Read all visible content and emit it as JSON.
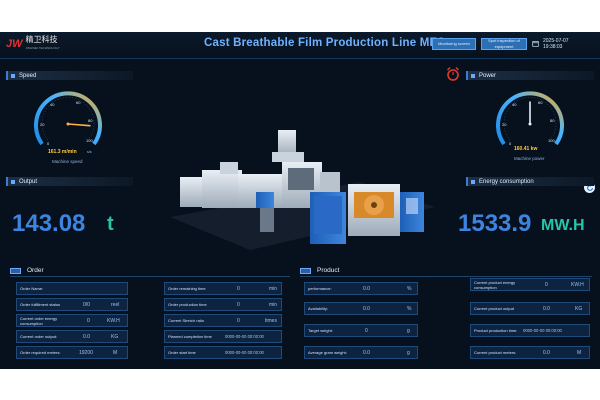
{
  "header": {
    "logo_mark": "JW",
    "logo_text": "精卫科技",
    "logo_sub": "JINGWEI TECHNOLOGY",
    "title": "Cast Breathable Film Production Line MES",
    "monitoring_btn": "Monitoring screen",
    "spot_btn": "Spot inspection of equipment",
    "date": "2025-07-07",
    "time": "19:38:03"
  },
  "speed": {
    "title": "Speed",
    "value": "161.3 m/min",
    "unit_small": "s/s",
    "caption": "Machine speed",
    "ticks": [
      "0",
      "20",
      "40",
      "60",
      "80",
      "100"
    ],
    "gauge_level": 0.85
  },
  "power": {
    "title": "Power",
    "value": "160.41 kw",
    "caption": "Machine power",
    "ticks": [
      "0",
      "20",
      "40",
      "60",
      "80",
      "100"
    ],
    "gauge_level": 0.5
  },
  "output": {
    "title": "Output",
    "value": "143.08",
    "unit": "t"
  },
  "energy": {
    "title": "Energy consumption",
    "value": "1533.9",
    "unit": "MW.H"
  },
  "order": {
    "title": "Order",
    "col1": [
      {
        "label": "Order Name:",
        "value": "",
        "unit": ""
      },
      {
        "label": "Order fulfillment status",
        "value": "0/0",
        "unit": "reel"
      },
      {
        "label": "Current order energy consumption",
        "value": "0",
        "unit": "KW.H"
      },
      {
        "label": "Current order output:",
        "value": "0.0",
        "unit": "KG"
      },
      {
        "label": "Order required meters:",
        "value": "19200",
        "unit": "M"
      }
    ],
    "col2": [
      {
        "label": "Order remaining time",
        "value": "0",
        "unit": "min"
      },
      {
        "label": "Order production time",
        "value": "0",
        "unit": "min"
      },
      {
        "label": "Current Stretch ratio",
        "value": "0",
        "unit": "times"
      },
      {
        "label": "Planned completion time",
        "value": "0000-00-00 00:00:00",
        "unit": ""
      },
      {
        "label": "Order start time",
        "value": "0000-00-00 00:00:00",
        "unit": ""
      }
    ]
  },
  "product": {
    "title": "Product",
    "col1": [
      {
        "label": "performance:",
        "value": "0.0",
        "unit": "%"
      },
      {
        "label": "Availability:",
        "value": "0.0",
        "unit": "%"
      },
      {
        "label": "Target weight:",
        "value": "0",
        "unit": "g"
      },
      {
        "label": "Average gram weight:",
        "value": "0.0",
        "unit": "g"
      }
    ],
    "col2": [
      {
        "label": "Current product energy consumption",
        "value": "0",
        "unit": "KW.H"
      },
      {
        "label": "Current product output",
        "value": "0.0",
        "unit": "KG"
      },
      {
        "label": "Product production time:",
        "value": "0000-00-00 00:00:00",
        "unit": ""
      },
      {
        "label": "Current product meters:",
        "value": "0.0",
        "unit": "M"
      }
    ]
  },
  "colors": {
    "accent": "#3d84e0",
    "teal": "#27c4a8",
    "alarm": "#e03a2a"
  }
}
